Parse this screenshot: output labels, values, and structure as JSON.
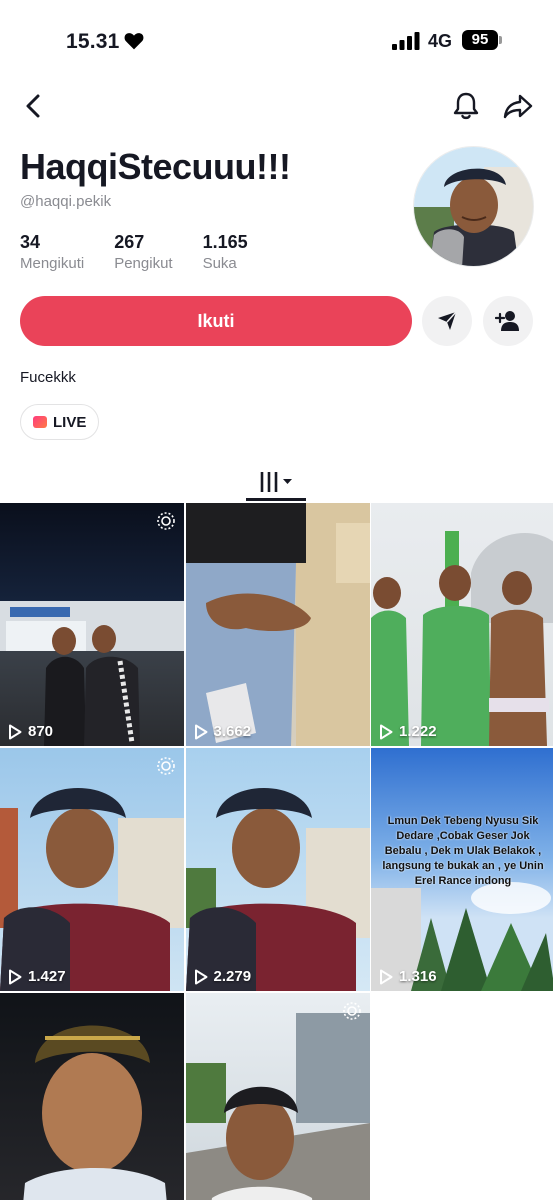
{
  "status_bar": {
    "time": "15.31",
    "network": "4G",
    "battery": "95"
  },
  "profile": {
    "display_name": "HaqqiStecuuu!!!",
    "handle": "@haqqi.pekik",
    "stats": [
      {
        "value": "34",
        "label": "Mengikuti"
      },
      {
        "value": "267",
        "label": "Pengikut"
      },
      {
        "value": "1.165",
        "label": "Suka"
      }
    ],
    "bio": "Fucekkk"
  },
  "actions": {
    "follow_label": "Ikuti",
    "live_label": "LIVE"
  },
  "videos": [
    {
      "views": "870",
      "pinned": true
    },
    {
      "views": "3.662",
      "pinned": false
    },
    {
      "views": "1.222",
      "pinned": false
    },
    {
      "views": "1.427",
      "pinned": true
    },
    {
      "views": "2.279",
      "pinned": false
    },
    {
      "views": "1.316",
      "pinned": false,
      "caption": "Lmun Dek Tebeng Nyusu Sik Dedare ,Cobak Geser Jok Bebalu , Dek m Ulak Belakok , langsung te bukak an , ye Unin Erel Rance indong"
    },
    {
      "views": "",
      "pinned": false
    },
    {
      "views": "",
      "pinned": true
    }
  ],
  "colors": {
    "follow": "#ea4359",
    "secondary_text": "#8a8b91"
  }
}
